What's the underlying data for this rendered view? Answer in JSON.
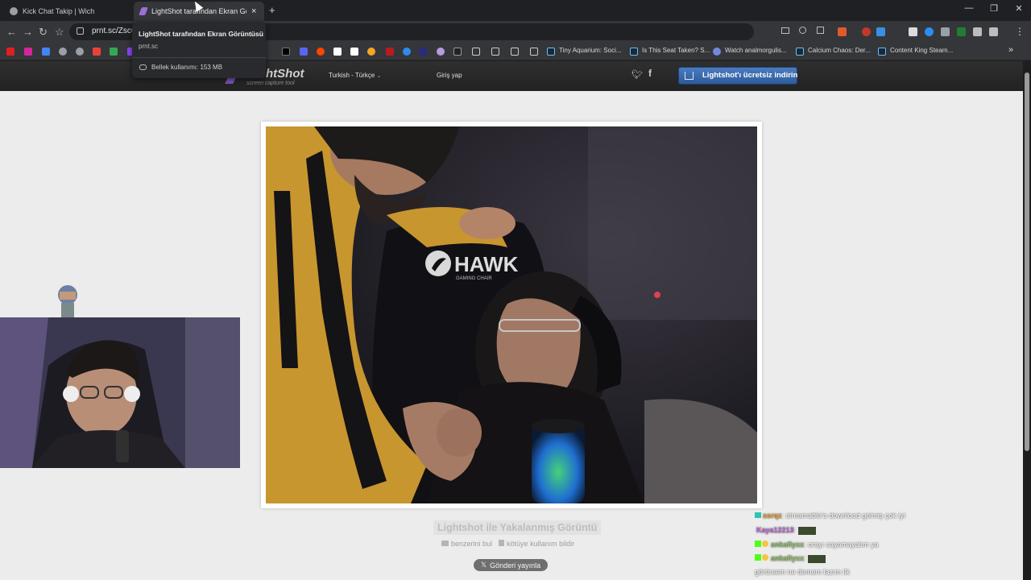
{
  "browser": {
    "tabs": [
      {
        "title": "Kick Chat Takip | Wich",
        "active": false
      },
      {
        "title": "LightShot tarafından Ekran Görü",
        "active": true
      }
    ],
    "new_tab": "+",
    "close_tab": "×",
    "window_controls": {
      "minimize": "—",
      "maximize": "❐",
      "close": "✕"
    },
    "nav": {
      "back": "←",
      "forward": "→",
      "reload": "↻",
      "bookmark": "☆"
    },
    "url": "prnt.sc/Zsc6",
    "menu": "⋮"
  },
  "bookmarks": [
    {
      "label": "Tiny Aquarium: Soci...",
      "color": "#4a90e2"
    },
    {
      "label": "Is This Seat Taken? S...",
      "color": "#4a90e2"
    },
    {
      "label": "Watch analmorgulis...",
      "color": "#7289da"
    },
    {
      "label": "Calcium Chaos: Der...",
      "color": "#4a90e2"
    },
    {
      "label": "Content King Steam...",
      "color": "#4a90e2"
    }
  ],
  "bookmarks_overflow": "»",
  "tooltip": {
    "title": "LightShot tarafından Ekran Görüntüsü",
    "domain": "prnt.sc",
    "memory": "Bellek kullanımı: 153 MB"
  },
  "site": {
    "logo_text": "htShot",
    "logo_subtitle": "screen capture tool",
    "language": "Turkish - Türkçe",
    "login": "Giriş yap",
    "download_button": "Lightshot'ı ücretsiz indirin",
    "caption": "Lightshot ile Yakalanmış Görüntü",
    "find_similar": "benzerini bul",
    "report_abuse": "kötüye kullanım bildir",
    "post_button": "Gönderi yayınla",
    "social": {
      "twitter": "twitter-icon",
      "facebook": "facebook-icon"
    }
  },
  "photo": {
    "chair_brand": "HAWK",
    "chair_sub": "GAMING CHAIR"
  },
  "chat": [
    {
      "user": "ssrqz",
      "color": "#e8a33c",
      "text": ": streamable'a download gelmiş çok iyi"
    },
    {
      "user": "Kaya12213",
      "color": "#c06bd8",
      "text": ":"
    },
    {
      "user": "ankaflyxx",
      "color": "#8ec06b",
      "text": ": orayı sayamayalım ya"
    },
    {
      "user": "ankaflyxx",
      "color": "#8ec06b",
      "text": ":"
    },
    {
      "user": "",
      "color": "#ffffff",
      "text": "görürsem ne demem lazım ilk"
    }
  ],
  "colors": {
    "page_bg": "#ececec",
    "header_bg": "#2a2a2a",
    "download_btn": "#3b6aa8"
  }
}
